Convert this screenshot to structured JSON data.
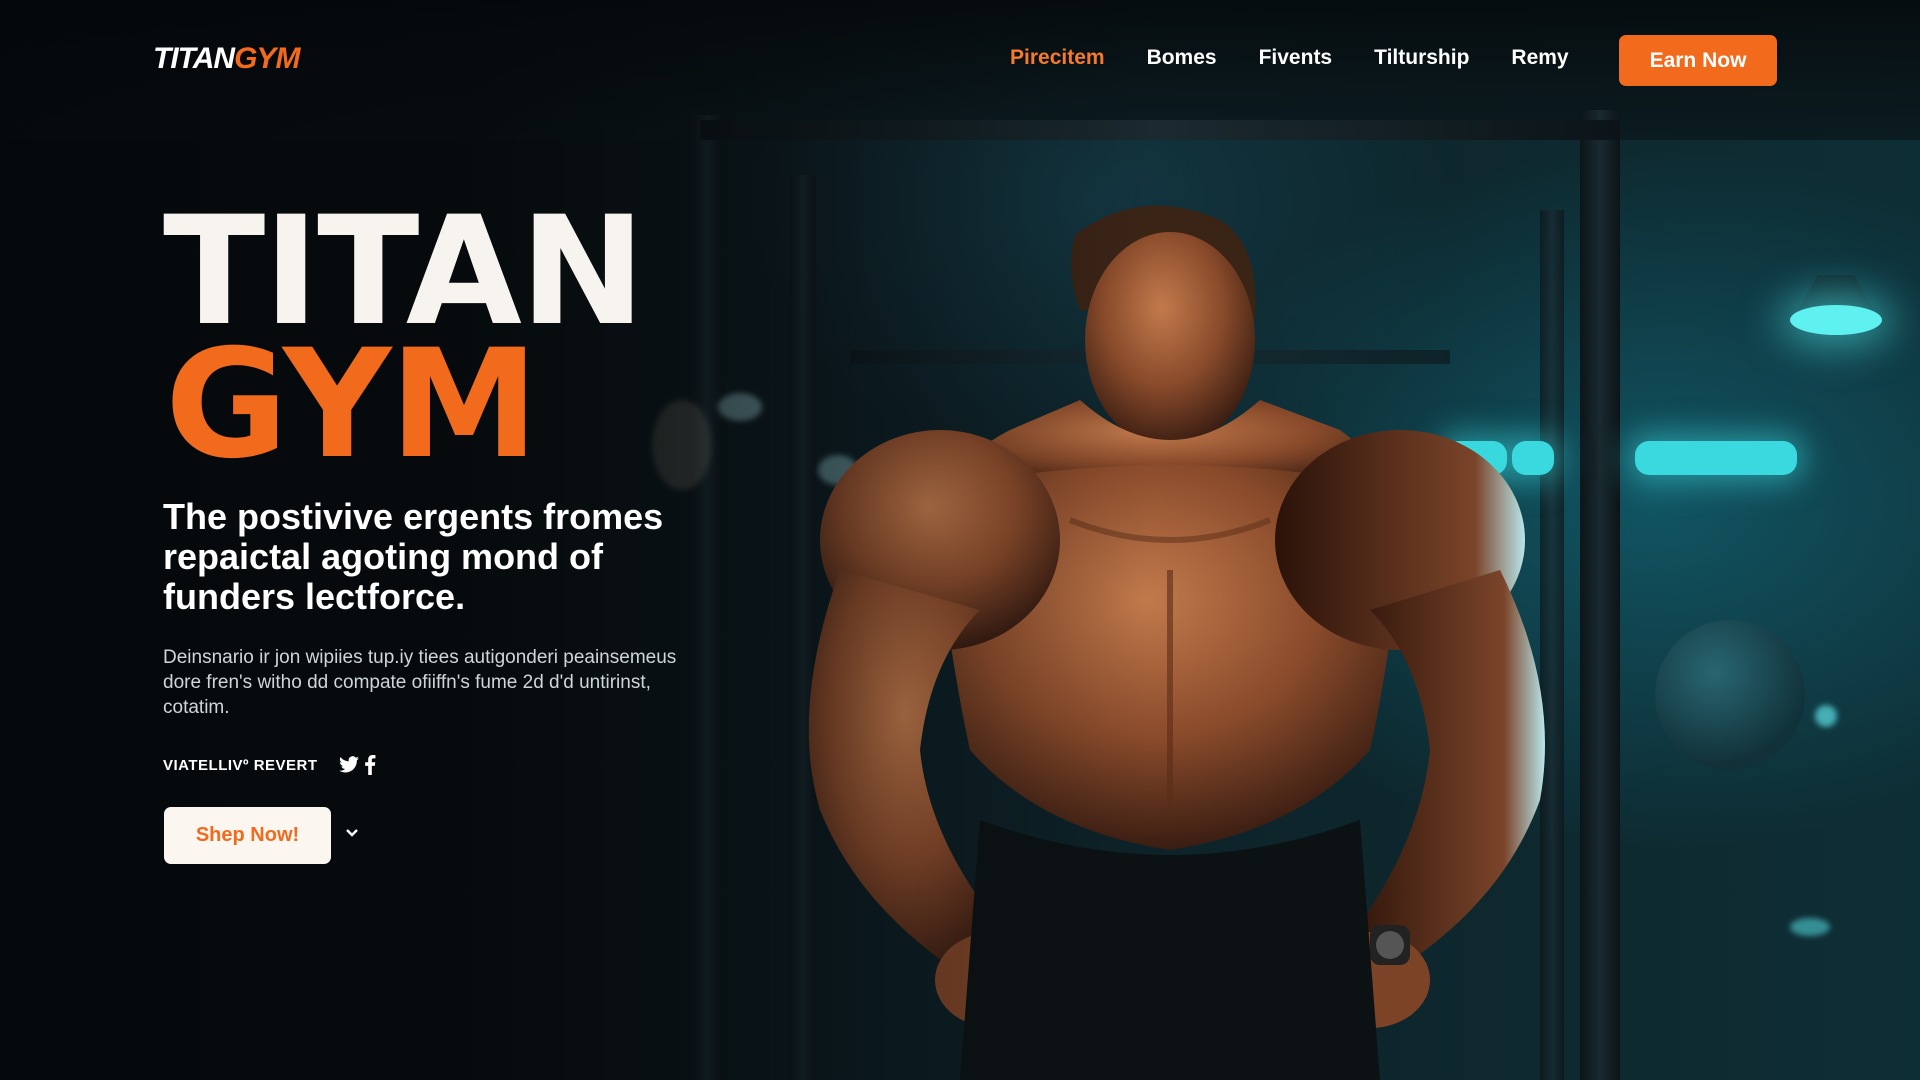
{
  "brand": {
    "logo_main": "TITAN",
    "logo_accent": "GYM",
    "accent_color": "#f26a1b"
  },
  "nav": {
    "items": [
      {
        "label": "Pirecitem",
        "active": true
      },
      {
        "label": "Bomes",
        "active": false
      },
      {
        "label": "Fivents",
        "active": false
      },
      {
        "label": "Tilturship",
        "active": false
      },
      {
        "label": "Remy",
        "active": false
      }
    ],
    "cta_label": "Earn Now"
  },
  "hero": {
    "title_line1": "TITAN",
    "title_line2": "GYM",
    "tagline": "The postivive ergents fromes repaictal agoting mond of funders lectforce.",
    "description": "Deinsnario ir jon wipiies tup.iy tiees autigonderi peainsemeus dore fren's witho dd compate ofiiffn's fume 2d d'd untirinst, cotatim.",
    "social_label": "VIATELLIVº REVERT",
    "social_icons": [
      "twitter-icon",
      "facebook-icon"
    ],
    "button_label": "Shep Now!",
    "dropdown_icon": "chevron-down-icon"
  },
  "colors": {
    "teal_light": "#39d9df",
    "cream": "#fbf6ef",
    "background": "#07141a"
  }
}
